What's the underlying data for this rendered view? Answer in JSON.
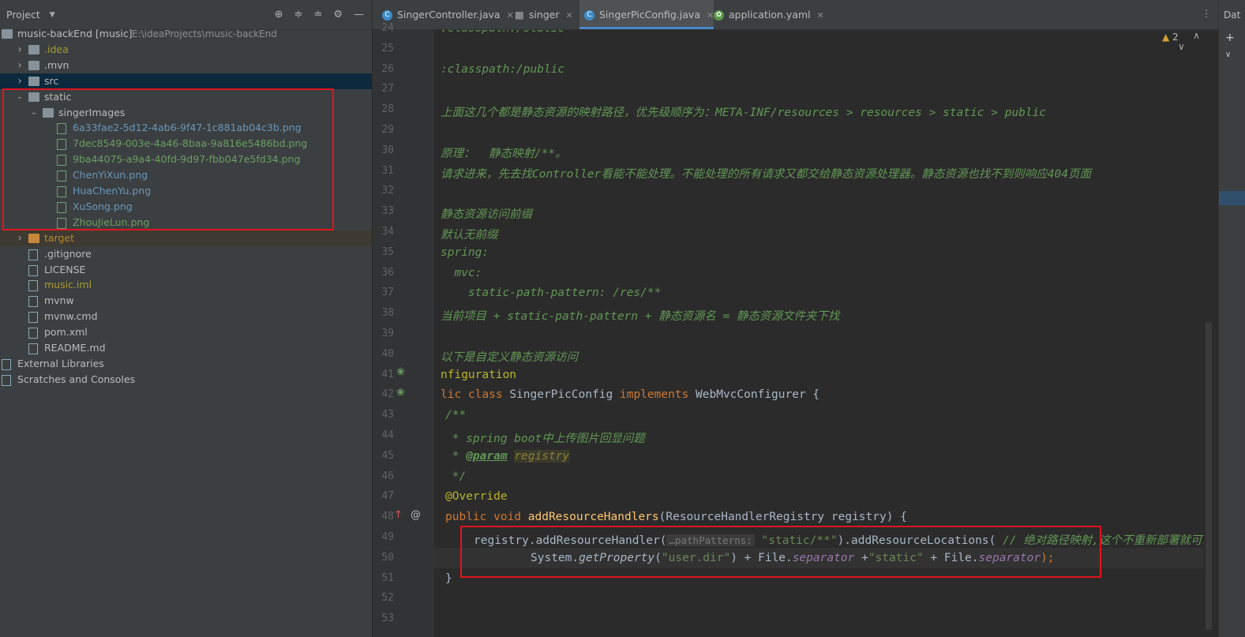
{
  "project_panel": {
    "title": "Project",
    "tree": [
      {
        "label": "music-backEnd [music]",
        "extra": "E:\\ideaProjects\\music-backEnd",
        "depth": 0,
        "kind": "module",
        "expanded": true
      },
      {
        "label": ".idea",
        "depth": 1,
        "kind": "folder",
        "expanded": false,
        "color": "yellow"
      },
      {
        "label": ".mvn",
        "depth": 1,
        "kind": "folder",
        "expanded": false
      },
      {
        "label": "src",
        "depth": 1,
        "kind": "folder",
        "expanded": false,
        "selected": true
      },
      {
        "label": "static",
        "depth": 1,
        "kind": "folder",
        "expanded": true
      },
      {
        "label": "singerImages",
        "depth": 2,
        "kind": "folder",
        "expanded": true
      },
      {
        "label": "6a33fae2-5d12-4ab6-9f47-1c881ab04c3b.png",
        "depth": 3,
        "kind": "png",
        "color": "blue"
      },
      {
        "label": "7dec8549-003e-4a46-8baa-9a816e5486bd.png",
        "depth": 3,
        "kind": "png",
        "color": "green"
      },
      {
        "label": "9ba44075-a9a4-40fd-9d97-fbb047e5fd34.png",
        "depth": 3,
        "kind": "png",
        "color": "green"
      },
      {
        "label": "ChenYiXun.png",
        "depth": 3,
        "kind": "png",
        "color": "blue"
      },
      {
        "label": "HuaChenYu.png",
        "depth": 3,
        "kind": "png",
        "color": "blue"
      },
      {
        "label": "XuSong.png",
        "depth": 3,
        "kind": "png",
        "color": "blue"
      },
      {
        "label": "ZhouJieLun.png",
        "depth": 3,
        "kind": "png",
        "color": "green"
      },
      {
        "label": "target",
        "depth": 1,
        "kind": "folder-orange",
        "expanded": false,
        "color": "orange",
        "highlight": true
      },
      {
        "label": ".gitignore",
        "depth": 1,
        "kind": "file"
      },
      {
        "label": "LICENSE",
        "depth": 1,
        "kind": "file"
      },
      {
        "label": "music.iml",
        "depth": 1,
        "kind": "file",
        "color": "yellow"
      },
      {
        "label": "mvnw",
        "depth": 1,
        "kind": "file"
      },
      {
        "label": "mvnw.cmd",
        "depth": 1,
        "kind": "file"
      },
      {
        "label": "pom.xml",
        "depth": 1,
        "kind": "maven"
      },
      {
        "label": "README.md",
        "depth": 1,
        "kind": "file"
      },
      {
        "label": "External Libraries",
        "depth": 0,
        "kind": "libs"
      },
      {
        "label": "Scratches and Consoles",
        "depth": 0,
        "kind": "scratch"
      }
    ]
  },
  "tabs": [
    {
      "label": "SingerController.java",
      "icon": "class-icon",
      "active": false
    },
    {
      "label": "singer",
      "icon": "table-icon",
      "active": false
    },
    {
      "label": "SingerPicConfig.java",
      "icon": "class-icon",
      "active": true
    },
    {
      "label": "application.yaml",
      "icon": "spring-leaf-icon",
      "active": false
    }
  ],
  "right_toolbar_label": "Dat",
  "inspection": {
    "warnings": "2"
  },
  "editor": {
    "lines": [
      {
        "n": "24",
        "text": ":classpath:/static"
      },
      {
        "n": "25",
        "text": ""
      },
      {
        "n": "26",
        "text": ":classpath:/public"
      },
      {
        "n": "27",
        "text": ""
      },
      {
        "n": "28",
        "text": "上面这几个都是静态资源的映射路径，优先级顺序为：META-INF/resources > resources > static > public"
      },
      {
        "n": "29",
        "text": ""
      },
      {
        "n": "30",
        "text": "原理：  静态映射/**。"
      },
      {
        "n": "31",
        "text": "请求进来，先去找Controller看能不能处理。不能处理的所有请求又都交给静态资源处理器。静态资源也找不到则响应404页面"
      },
      {
        "n": "32",
        "text": ""
      },
      {
        "n": "33",
        "text": "静态资源访问前缀"
      },
      {
        "n": "34",
        "text": "默认无前缀"
      },
      {
        "n": "35",
        "text": "spring:"
      },
      {
        "n": "36",
        "text": "  mvc:"
      },
      {
        "n": "37",
        "text": "    static-path-pattern: /res/**"
      },
      {
        "n": "38",
        "text": "当前项目 + static-path-pattern + 静态资源名 = 静态资源文件夹下找"
      },
      {
        "n": "39",
        "text": ""
      },
      {
        "n": "40",
        "text": "以下是自定义静态资源访问"
      },
      {
        "n": "41",
        "text": "nfiguration"
      },
      {
        "n": "42",
        "text": "lic class SingerPicConfig implements WebMvcConfigurer {"
      },
      {
        "n": "43",
        "text": "/**"
      },
      {
        "n": "44",
        "text": " * spring boot中上传图片回显问题"
      },
      {
        "n": "45",
        "text": " * @param registry"
      },
      {
        "n": "46",
        "text": " */"
      },
      {
        "n": "47",
        "text": "@Override"
      },
      {
        "n": "48",
        "text": "public void addResourceHandlers(ResourceHandlerRegistry registry) {"
      },
      {
        "n": "49",
        "text": "registry.addResourceHandler("
      },
      {
        "n": "50",
        "text": "System.getProperty(\"user.dir\") + File.separator +\"static\" + File.separator);"
      },
      {
        "n": "51",
        "text": "}"
      },
      {
        "n": "52",
        "text": ""
      },
      {
        "n": "53",
        "text": ""
      }
    ],
    "tokens": {
      "l41_ann": "nfiguration",
      "l42_kw1": "lic class ",
      "l42_name": "SingerPicConfig ",
      "l42_kw2": "implements ",
      "l42_iface": "WebMvcConfigurer {",
      "l44_a": " * spring boot",
      "l44_b": "中上传图片回显问题",
      "l45_a": " * ",
      "l45_tag": "@param",
      "l45_b": " ",
      "l45_param": "registry",
      "l47": "@Override",
      "l48_kw": "public void ",
      "l48_m": "addResourceHandlers",
      "l48_rest": "(ResourceHandlerRegistry registry) {",
      "l49_a": "registry.addResourceHandler(",
      "l49_hint": "…pathPatterns:",
      "l49_str": "\"static/**\"",
      "l49_b": ").addResourceLocations(",
      "l49_cm": " // 绝对路径映射,这个不重新部署就可以",
      "l50_a": "System.",
      "l50_m": "getProperty",
      "l50_b": "(",
      "l50_s1": "\"user.dir\"",
      "l50_c": ") + File.",
      "l50_f1": "separator",
      "l50_d": " +",
      "l50_s2": "\"static\"",
      "l50_e": " + File.",
      "l50_f2": "separator",
      "l50_g": ");"
    }
  }
}
